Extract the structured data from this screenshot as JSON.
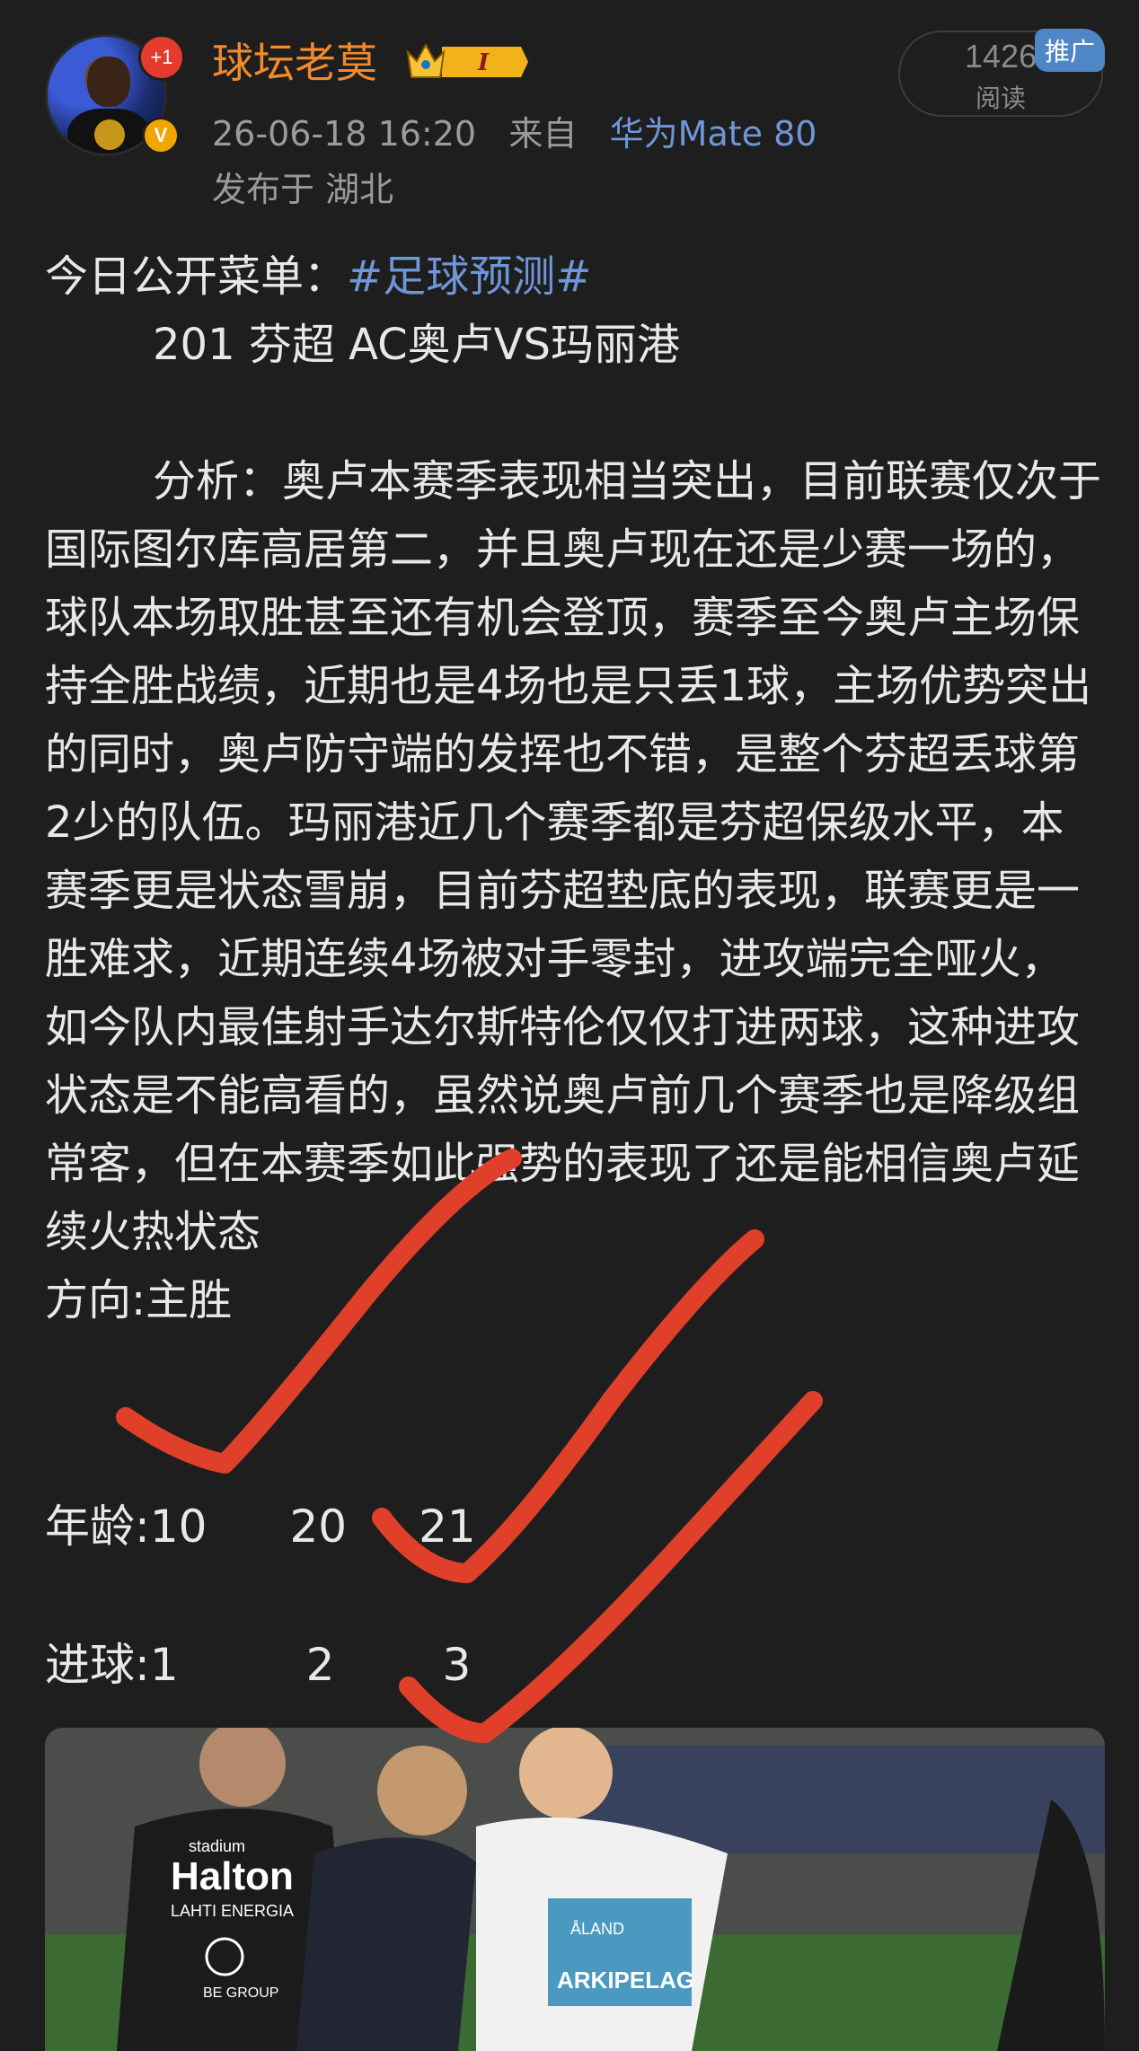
{
  "author": {
    "name": "球坛老莫",
    "plus_badge": "+1",
    "verified_badge": "V",
    "vip_level": "I"
  },
  "meta": {
    "time": "26-06-18 16:20",
    "source_prefix": "来自",
    "device": "华为Mate 80",
    "location": "发布于 湖北"
  },
  "read": {
    "count": "1426",
    "label": "阅读",
    "ad_tag": "推广"
  },
  "post": {
    "intro": "今日公开菜单：",
    "hashtag": "#足球预测#",
    "match": "201 芬超 AC奥卢VS玛丽港",
    "analysis": "分析：奥卢本赛季表现相当突出，目前联赛仅次于国际图尔库高居第二，并且奥卢现在还是少赛一场的，球队本场取胜甚至还有机会登顶，赛季至今奥卢主场保持全胜战绩，近期也是4场也是只丢1球，主场优势突出的同时，奥卢防守端的发挥也不错，是整个芬超丢球第2少的队伍。玛丽港近几个赛季都是芬超保级水平，本赛季更是状态雪崩，目前芬超垫底的表现，联赛更是一胜难求，近期连续4场被对手零封，进攻端完全哑火，如今队内最佳射手达尔斯特伦仅仅打进两球，这种进攻状态是不能高看的，虽然说奥卢前几个赛季也是降级组常客，但在本赛季如此强势的表现了还是能相信奥卢延续火热状态",
    "direction": "方向:主胜"
  },
  "age_row": {
    "label": "年龄:",
    "v1": "10",
    "v2": "20",
    "v3": "21"
  },
  "goals_row": {
    "label": "进球:",
    "v1": "1",
    "v2": "2",
    "v3": "3"
  },
  "photo": {
    "sponsors": [
      "stadium",
      "Halton",
      "LAHTI ENERGIA",
      "BE GROUP",
      "ÅLAND",
      "ARKIPELAG"
    ]
  },
  "colors": {
    "username": "#f08a2c",
    "link": "#6e96d8",
    "checkmark": "#e0402a",
    "ad": "#4f86c6"
  }
}
